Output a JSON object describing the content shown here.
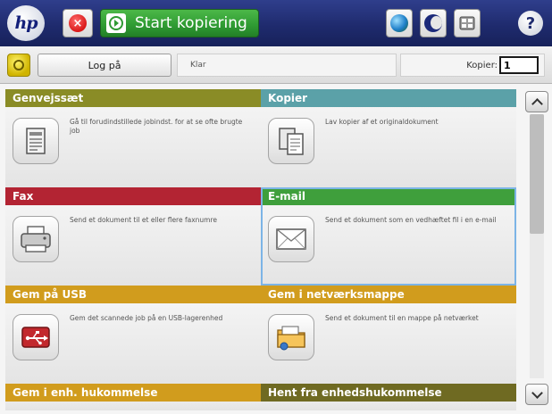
{
  "topbar": {
    "logo": "hp",
    "stop_symbol": "×",
    "start_label": "Start kopiering",
    "help_symbol": "?"
  },
  "statusbar": {
    "login_label": "Log på",
    "status_text": "Klar",
    "copies_label": "Kopier:",
    "copies_value": "1"
  },
  "tiles": [
    {
      "title": "Genvejssæt",
      "desc": "Gå til forudindstillede jobindst. for at se ofte brugte job",
      "color": "#8a8c26",
      "icon": "shortcut-document-icon"
    },
    {
      "title": "Kopier",
      "desc": "Lav kopier af et originaldokument",
      "color": "#5ba1a8",
      "icon": "copy-documents-icon"
    },
    {
      "title": "Fax",
      "desc": "Send et dokument til et eller flere faxnumre",
      "color": "#b32433",
      "icon": "fax-machine-icon"
    },
    {
      "title": "E-mail",
      "desc": "Send et dokument som en vedhæftet fil i en e-mail",
      "color": "#3f9f3c",
      "icon": "envelope-icon"
    },
    {
      "title": "Gem på USB",
      "desc": "Gem det scannede job på en USB-lagerenhed",
      "color": "#d19c1d",
      "icon": "usb-storage-icon"
    },
    {
      "title": "Gem i netværksmappe",
      "desc": "Send et dokument til en mappe på netværket",
      "color": "#d19c1d",
      "icon": "network-folder-icon"
    },
    {
      "title": "Gem i enh. hukommelse",
      "color": "#d19c1d"
    },
    {
      "title": "Hent fra enhedshukommelse",
      "color": "#6f6a22"
    }
  ]
}
